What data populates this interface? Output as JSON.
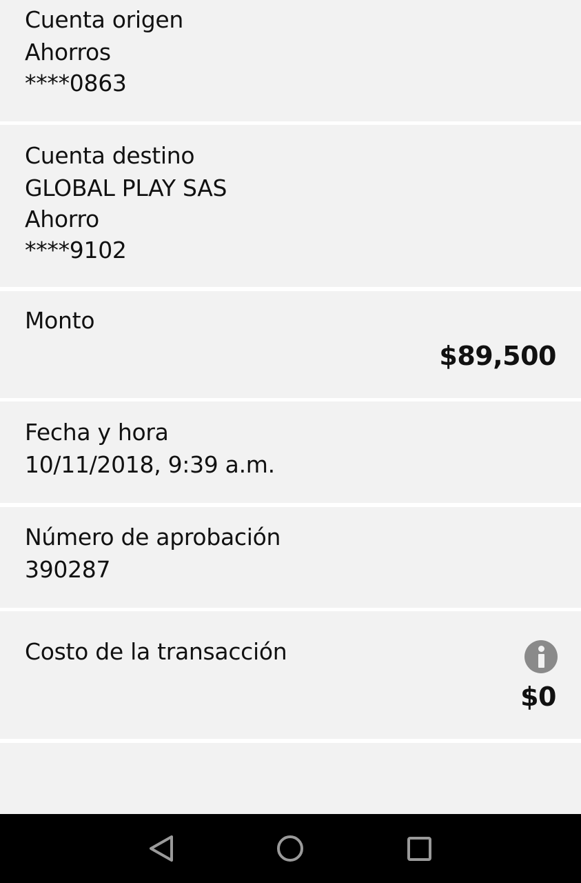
{
  "origin": {
    "label": "Cuenta origen",
    "account_type": "Ahorros",
    "account_number": "****0863"
  },
  "destination": {
    "label": "Cuenta destino",
    "name": "GLOBAL PLAY SAS",
    "account_type": "Ahorro",
    "account_number": "****9102"
  },
  "amount": {
    "label": "Monto",
    "value": "$89,500"
  },
  "datetime": {
    "label": "Fecha y hora",
    "value": "10/11/2018, 9:39 a.m."
  },
  "approval": {
    "label": "Número de aprobación",
    "value": "390287"
  },
  "cost": {
    "label": "Costo de la transacción",
    "value": "$0",
    "icon": "info-icon"
  },
  "navbar": {
    "back_icon": "back-triangle-icon",
    "home_icon": "home-circle-icon",
    "recents_icon": "recents-square-icon"
  },
  "colors": {
    "section_bg": "#f2f2f2",
    "separator": "#ffffff",
    "navbar_bg": "#000000",
    "info_icon": "#8a8a8a"
  }
}
